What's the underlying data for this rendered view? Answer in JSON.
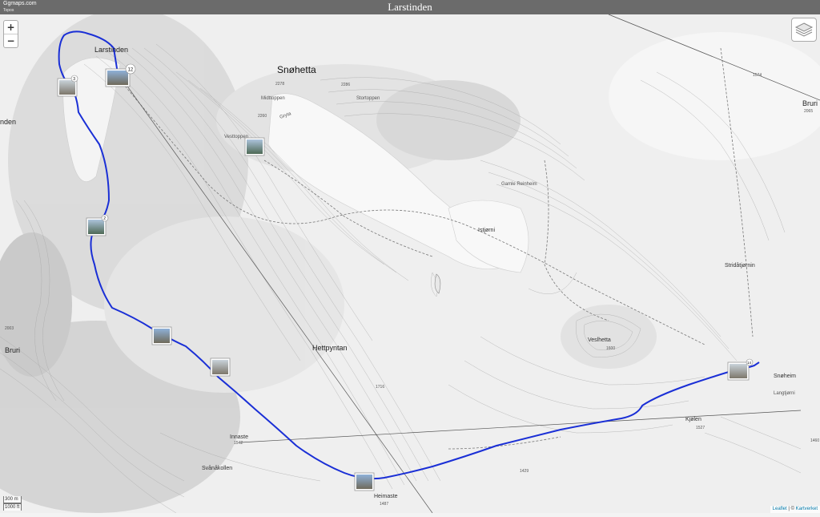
{
  "title": "Larstinden",
  "logo": {
    "name": "Ggmaps.com",
    "sub": "Topos"
  },
  "controls": {
    "zoom_in": "+",
    "zoom_out": "−"
  },
  "scale": {
    "metric": "300 m",
    "imperial": "1000 ft"
  },
  "attribution": {
    "leaflet": "Leaflet",
    "sep": " | © ",
    "provider": "Kartverket"
  },
  "labels": {
    "larstinden": "Larstinden",
    "snohetta": "Snøhetta",
    "e2278": "2278",
    "e2286": "2286",
    "midttoppen": "Midttoppen",
    "storttoppen": "Stortoppen",
    "e2260": "2260",
    "gryta": "Gryta",
    "vesttoppen": "Vesttoppen",
    "gamle_reinheim": "Gamle Reinheim",
    "istjorni": "Istjørni",
    "stridatjornin": "Stridåtjørnin",
    "hettpyntan": "Hettpyntan",
    "veslhetta": "Veslhetta",
    "e1600": "1600",
    "e1716": "1716",
    "snoheim": "Snøheim",
    "langtjorni": "Langtjørni",
    "kjolen": "Kjølen",
    "e1527": "1527",
    "innaste": "Innaste",
    "e1542": "1542",
    "svanakollen": "Svånåkollen",
    "heimaste": "Heimaste",
    "e1487": "1487",
    "e1429": "1429",
    "bruri_w": "Bruri",
    "bruri_e": "Bruri",
    "e2003": "2003",
    "e2065": "2065",
    "e1574": "1574",
    "e1460": "1460",
    "nden": "nden"
  },
  "markers": {
    "m12": "12",
    "m3": "3",
    "m2": "2",
    "m14": "14"
  },
  "colors": {
    "route": "#1a2fd6",
    "title_bar": "#6b6b6b"
  }
}
